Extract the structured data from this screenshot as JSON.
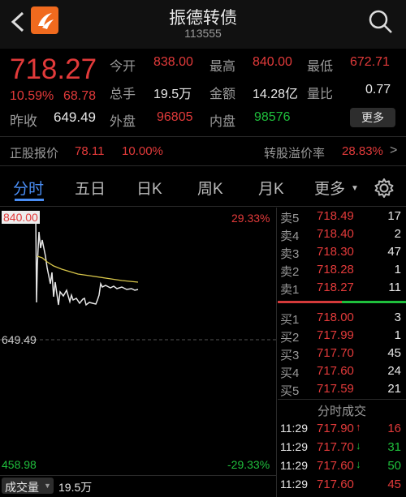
{
  "header": {
    "title": "振德转债",
    "code": "113555"
  },
  "quote": {
    "price": "718.27",
    "change_pct": "10.59%",
    "change": "68.78",
    "prev_close_label": "昨收",
    "prev_close": "649.49",
    "open_label": "今开",
    "open": "838.00",
    "high_label": "最高",
    "high": "840.00",
    "low_label": "最低",
    "low": "672.71",
    "volume_label": "总手",
    "volume": "19.5万",
    "amount_label": "金额",
    "amount": "14.28亿",
    "ratio_label": "量比",
    "ratio": "0.77",
    "outer_label": "外盘",
    "outer": "96805",
    "inner_label": "内盘",
    "inner": "98576",
    "more_label": "更多"
  },
  "conv": {
    "stock_label": "正股报价",
    "stock_price": "78.11",
    "stock_pct": "10.00%",
    "premium_label": "转股溢价率",
    "premium": "28.83%",
    "arrow": ">"
  },
  "tabs": [
    "分时",
    "五日",
    "日K",
    "周K",
    "月K",
    "更多"
  ],
  "chart": {
    "top_price": "840.00",
    "top_pct": "29.33%",
    "mid_price": "649.49",
    "bottom_price": "458.98",
    "bottom_pct": "-29.33%"
  },
  "order_book": {
    "asks": [
      {
        "label": "卖5",
        "price": "718.49",
        "qty": "17"
      },
      {
        "label": "卖4",
        "price": "718.40",
        "qty": "2"
      },
      {
        "label": "卖3",
        "price": "718.30",
        "qty": "47"
      },
      {
        "label": "卖2",
        "price": "718.28",
        "qty": "1"
      },
      {
        "label": "卖1",
        "price": "718.27",
        "qty": "11"
      }
    ],
    "bids": [
      {
        "label": "买1",
        "price": "718.00",
        "qty": "3"
      },
      {
        "label": "买2",
        "price": "717.99",
        "qty": "1"
      },
      {
        "label": "买3",
        "price": "717.70",
        "qty": "45"
      },
      {
        "label": "买4",
        "price": "717.60",
        "qty": "24"
      },
      {
        "label": "买5",
        "price": "717.59",
        "qty": "21"
      }
    ]
  },
  "ticks": {
    "title": "分时成交",
    "rows": [
      {
        "time": "11:29",
        "price": "717.90",
        "arrow": "↑",
        "qty": "16"
      },
      {
        "time": "11:29",
        "price": "717.70",
        "arrow": "↓",
        "qty": "31"
      },
      {
        "time": "11:29",
        "price": "717.60",
        "arrow": "↓",
        "qty": "50"
      },
      {
        "time": "11:29",
        "price": "717.60",
        "arrow": "",
        "qty": "45"
      }
    ]
  },
  "footer": {
    "volume_label": "成交量",
    "volume_value": "19.5万"
  },
  "colors": {
    "up": "#e23a3a",
    "down": "#1fbf3c",
    "avg_line": "#d8c64a",
    "price_line": "#e8e8e8"
  },
  "icons": {
    "back": "back-arrow-icon",
    "logo": "app-logo-icon",
    "search": "search-icon",
    "settings": "gear-icon"
  }
}
